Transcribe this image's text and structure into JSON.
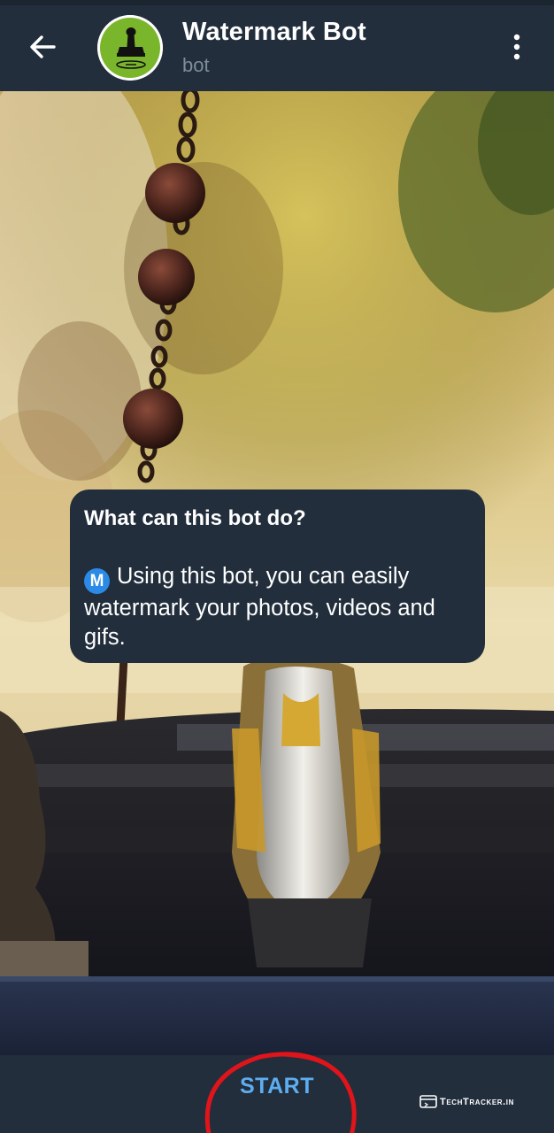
{
  "header": {
    "title": "Watermark Bot",
    "subtitle": "bot",
    "back_icon": "arrow-left-icon",
    "menu_icon": "more-vertical-icon",
    "avatar_icon": "rubber-stamp-icon"
  },
  "info_card": {
    "title": "What can this bot do?",
    "badge_letter": "M",
    "description": "Using this bot, you can easily watermark your photos, videos and gifs."
  },
  "bottom_bar": {
    "start_label": "START"
  },
  "overlay": {
    "watermark_text": "TechTracker.in",
    "annotation_color": "#e0141b"
  },
  "colors": {
    "header_bg": "#222e3c",
    "card_bg": "#222e3c",
    "accent": "#5eadf0",
    "avatar_green": "#7ab62c"
  }
}
